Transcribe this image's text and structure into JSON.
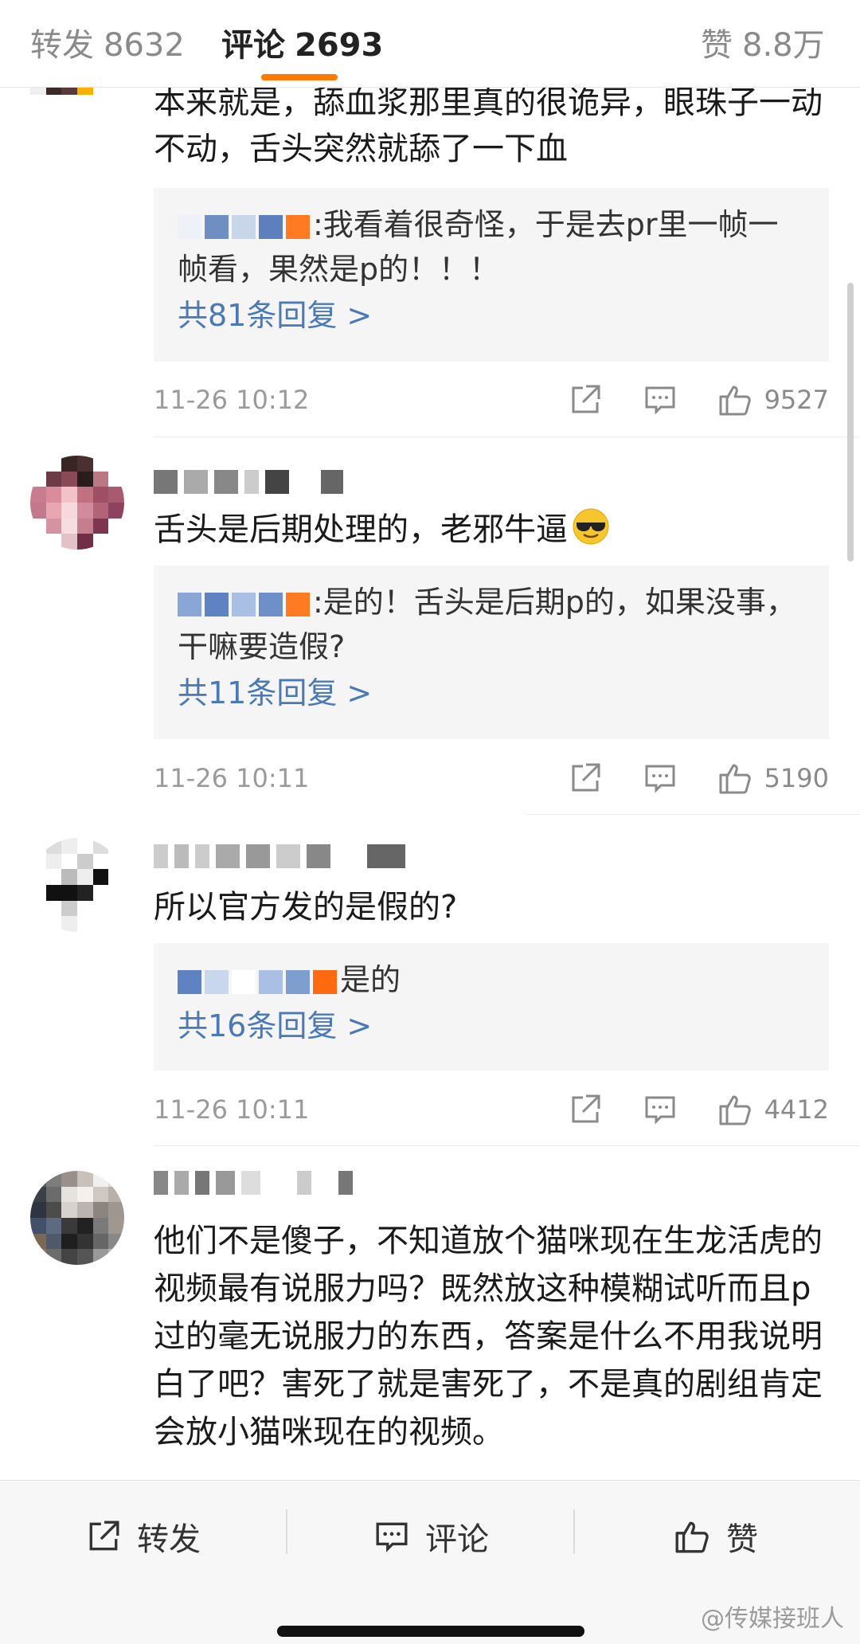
{
  "tabs": {
    "repost": {
      "label": "转发",
      "count": "8632"
    },
    "comment": {
      "label": "评论",
      "count": "2693"
    },
    "like": {
      "label": "赞",
      "count": "8.8万"
    }
  },
  "comments": [
    {
      "text": "本来就是，舔血浆那里真的很诡异，眼珠子一动不动，舌头突然就舔了一下血",
      "reply_text": ":我看着很奇怪，于是去pr里一帧一帧看，果然是p的！！！",
      "reply_more": "共81条回复 >",
      "time": "11-26 10:12",
      "likes": "9527"
    },
    {
      "text": "舌头是后期处理的，老邪牛逼",
      "reply_text": ":是的！舌头是后期p的，如果没事，干嘛要造假?",
      "reply_more": "共11条回复 >",
      "time": "11-26 10:11",
      "likes": "5190"
    },
    {
      "text": "所以官方发的是假的?",
      "reply_text": "是的",
      "reply_more": "共16条回复 >",
      "time": "11-26 10:11",
      "likes": "4412"
    },
    {
      "text": "他们不是傻子，不知道放个猫咪现在生龙活虎的视频最有说服力吗？既然放这种模糊试听而且p过的毫无说服力的东西，答案是什么不用我说明白了吧？害死了就是害死了，不是真的剧组肯定会放小猫咪现在的视频。"
    }
  ],
  "bottom_bar": {
    "repost": "转发",
    "comment": "评论",
    "like": "赞"
  },
  "watermark": "@传媒接班人",
  "icons": [
    "share-icon",
    "comment-icon",
    "like-icon",
    "sunglasses-emoji"
  ],
  "colors": {
    "accent": "#ff7a00",
    "link": "#4a79b5",
    "reply_bg": "#f5f5f5"
  }
}
